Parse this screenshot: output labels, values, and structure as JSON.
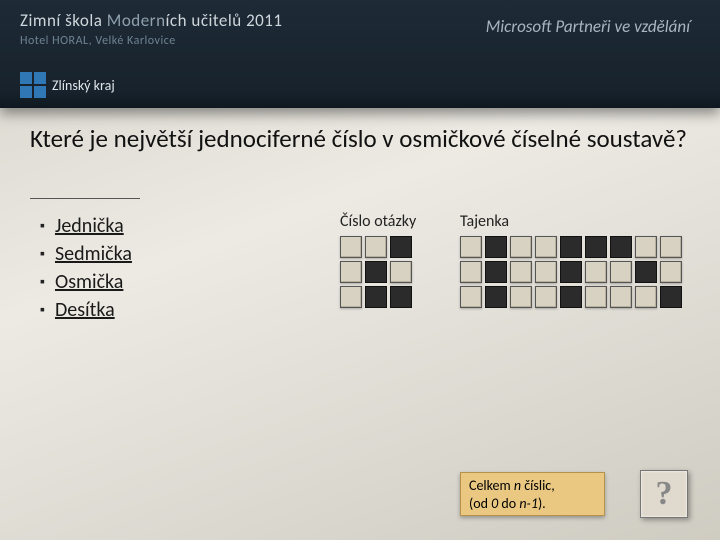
{
  "header": {
    "title_prefix": "Zimní škola ",
    "title_em": "Modern",
    "title_suffix": "ích učitelů 2011",
    "subtitle": "Hotel HORAL, Velké Karlovice",
    "partner": "Microsoft Partneři ve vzdělání",
    "logo_text": "Zlínský kraj"
  },
  "question": "Které je největší jednociferné číslo v osmičkové číselné soustavě?",
  "answers": [
    "Jednička",
    "Sedmička",
    "Osmička",
    "Desítka"
  ],
  "labels": {
    "cislo": "Číslo otázky",
    "tajenka": "Tajenka"
  },
  "grid_left": {
    "cols": 3,
    "rows": 3,
    "dark": [
      [
        0,
        2
      ],
      [
        1,
        1
      ],
      [
        2,
        1
      ],
      [
        2,
        2
      ]
    ]
  },
  "grid_right": {
    "cols": 9,
    "rows": 3,
    "dark": [
      [
        0,
        1
      ],
      [
        0,
        4
      ],
      [
        0,
        5
      ],
      [
        0,
        6
      ],
      [
        1,
        1
      ],
      [
        1,
        4
      ],
      [
        1,
        7
      ],
      [
        2,
        1
      ],
      [
        2,
        4
      ],
      [
        2,
        8
      ]
    ]
  },
  "footer": {
    "line1_a": "Celkem ",
    "line1_n": "n",
    "line1_b": " číslic,",
    "line2_a": "(od ",
    "line2_zero": "0",
    "line2_b": " do ",
    "line2_n1": "n-1",
    "line2_c": ")."
  },
  "qmark": "?"
}
